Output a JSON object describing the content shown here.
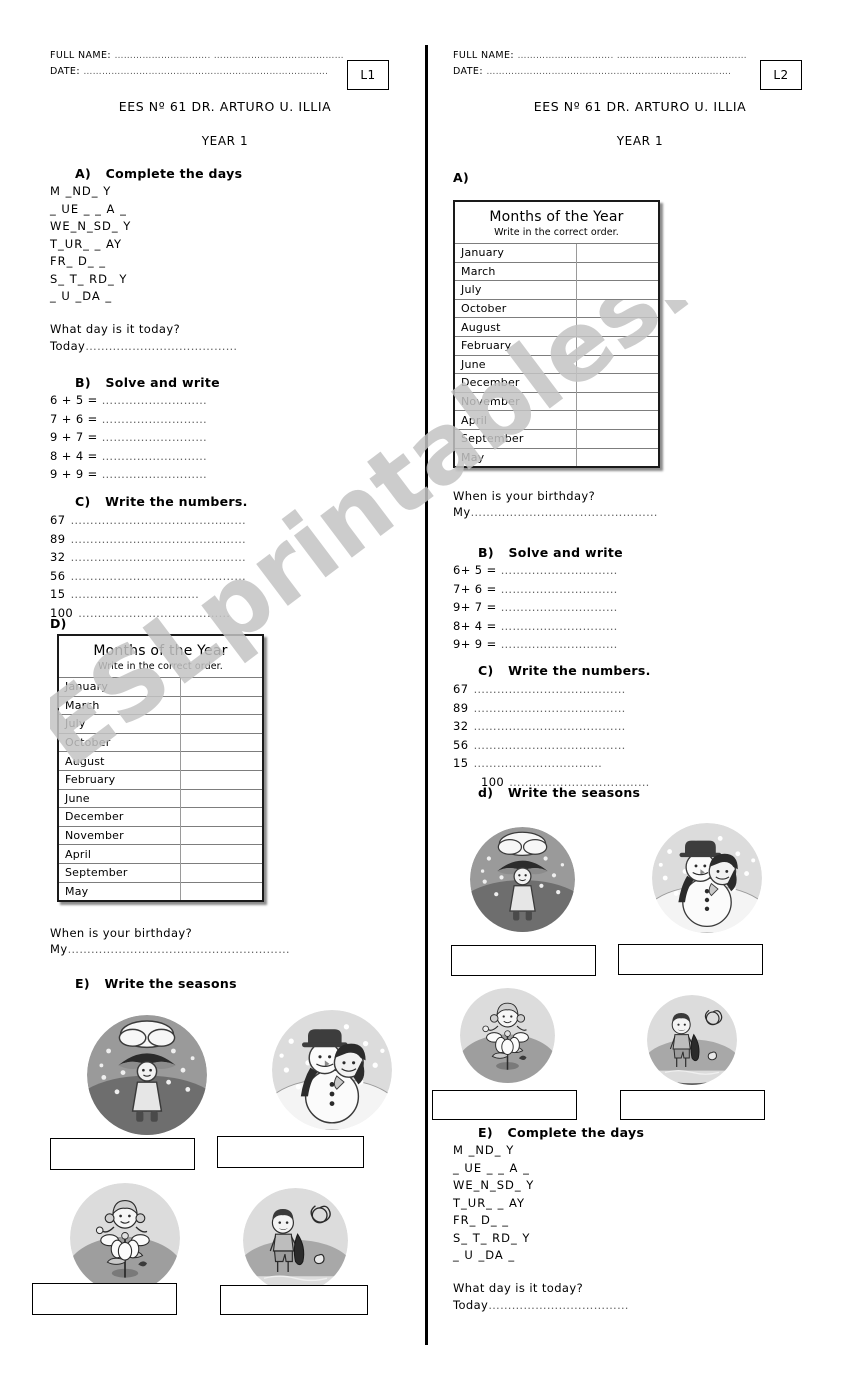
{
  "watermark": "ESLprintables.com",
  "header": {
    "full_name_label": "FULL NAME:",
    "date_label": "DATE:",
    "name_dots": "…………………………. ……………………………………",
    "date_dots": "…………………………………………………………………….",
    "school": "EES Nº 61 DR. ARTURO U. ILLIA",
    "year": "YEAR 1"
  },
  "left": {
    "badge": "L1",
    "sections": {
      "a": {
        "letter": "A)",
        "title": "Complete the days"
      },
      "b": {
        "letter": "B)",
        "title": "Solve and write"
      },
      "c": {
        "letter": "C)",
        "title": "Write the numbers."
      },
      "d": {
        "letter": "D)",
        "title": ""
      },
      "e": {
        "letter": "E)",
        "title": "Write the seasons"
      }
    },
    "days": "M _ND_ Y\n_ UE _ _ A _\nWE_N_SD_ Y\nT_UR_ _ AY\nFR_ D_ _\nS_ T_ RD_ Y\n_ U _DA _",
    "today_question": "What day is it today?",
    "today_answer": "Today",
    "today_dots": "…………………………………",
    "sums": [
      {
        "problem": "6 + 5 =",
        "dots": "………………………"
      },
      {
        "problem": "7 + 6 =",
        "dots": "………………………"
      },
      {
        "problem": "9 + 7 =",
        "dots": "………………………"
      },
      {
        "problem": "8 + 4 =",
        "dots": "………………………"
      },
      {
        "problem": "9 + 9 =",
        "dots": "………………………"
      }
    ],
    "numbers": [
      {
        "value": "67",
        "dots": "………………………………………"
      },
      {
        "value": "89",
        "dots": "………………………………………"
      },
      {
        "value": "32",
        "dots": "………………………………………"
      },
      {
        "value": "56",
        "dots": "………………………………………"
      },
      {
        "value": "15",
        "dots": "……………………………"
      },
      {
        "value": "100",
        "dots": "…………………………………"
      }
    ],
    "birthday_question": "When is your birthday?",
    "birthday_answer": "My",
    "birthday_dots": "…………………………………………………"
  },
  "right": {
    "badge": "L2",
    "sections": {
      "a": {
        "letter": "A)",
        "title": ""
      },
      "b": {
        "letter": "B)",
        "title": "Solve and write"
      },
      "c": {
        "letter": "C)",
        "title": "Write the numbers."
      },
      "d": {
        "letter": "d)",
        "title": "Write the seasons"
      },
      "e": {
        "letter": "E)",
        "title": "Complete the days"
      }
    },
    "days": "M _ND_ Y\n_ UE _ _ A _\nWE_N_SD_ Y\nT_UR_ _ AY\nFR_ D_ _\nS_ T_ RD_ Y\n_ U _DA _",
    "today_question": "What day is it today?",
    "today_answer": "Today",
    "today_dots": "………………………………",
    "sums": [
      {
        "problem": "6+ 5 =",
        "dots": "…………………………"
      },
      {
        "problem": "7+ 6 =",
        "dots": "…………………………"
      },
      {
        "problem": "9+ 7 =",
        "dots": "…………………………"
      },
      {
        "problem": "8+ 4 =",
        "dots": "…………………………"
      },
      {
        "problem": "9+ 9 =",
        "dots": "…………………………"
      }
    ],
    "numbers": [
      {
        "value": "67",
        "dots": "…………………………………"
      },
      {
        "value": "89",
        "dots": "…………………………………"
      },
      {
        "value": "32",
        "dots": "…………………………………"
      },
      {
        "value": "56",
        "dots": "…………………………………"
      },
      {
        "value": "15",
        "dots": "……………………………"
      },
      {
        "value": "100",
        "dots": "………………………………"
      }
    ],
    "birthday_question": "When is your birthday?",
    "birthday_answer": "My",
    "birthday_dots": "…………………………………………"
  },
  "months_card": {
    "title": "Months of the Year",
    "subtitle": "Write in the correct order.",
    "months": [
      "January",
      "March",
      "July",
      "October",
      "August",
      "February",
      "June",
      "December",
      "November",
      "April",
      "September",
      "May"
    ]
  },
  "seasons": [
    {
      "name": "autumn-rain",
      "answer": ""
    },
    {
      "name": "winter-snowman",
      "answer": ""
    },
    {
      "name": "spring-flower",
      "answer": ""
    },
    {
      "name": "summer-surf",
      "answer": ""
    }
  ]
}
